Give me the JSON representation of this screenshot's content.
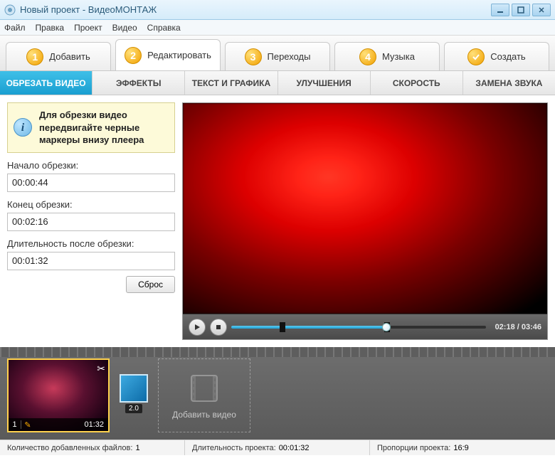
{
  "window": {
    "title": "Новый проект - ВидеоМОНТАЖ"
  },
  "menu": {
    "file": "Файл",
    "edit": "Правка",
    "project": "Проект",
    "video": "Видео",
    "help": "Справка"
  },
  "steps": {
    "add": "Добавить",
    "editStep": "Редактировать",
    "transitions": "Переходы",
    "music": "Музыка",
    "create": "Создать"
  },
  "subtabs": {
    "trim": "ОБРЕЗАТЬ ВИДЕО",
    "effects": "ЭФФЕКТЫ",
    "textgfx": "ТЕКСТ И ГРАФИКА",
    "improve": "УЛУЧШЕНИЯ",
    "speed": "СКОРОСТЬ",
    "audioswap": "ЗАМЕНА ЗВУКА"
  },
  "hint_text": "Для обрезки видео передвигайте черные маркеры внизу плеера",
  "trim": {
    "start_label": "Начало обрезки:",
    "start_value": "00:00:44",
    "end_label": "Конец обрезки:",
    "end_value": "00:02:16",
    "after_label": "Длительность после обрезки:",
    "after_value": "00:01:32",
    "reset": "Сброс"
  },
  "player": {
    "time": "02:18 / 03:46",
    "scrub_percent": 61,
    "marker_start_percent": 19,
    "marker_end_percent": 60
  },
  "timeline": {
    "clip": {
      "index": "1",
      "duration": "01:32"
    },
    "transition_label": "2.0",
    "add_label": "Добавить видео"
  },
  "status": {
    "files_label": "Количество добавленных файлов:",
    "files_value": "1",
    "duration_label": "Длительность проекта:",
    "duration_value": "00:01:32",
    "aspect_label": "Пропорции проекта:",
    "aspect_value": "16:9"
  }
}
